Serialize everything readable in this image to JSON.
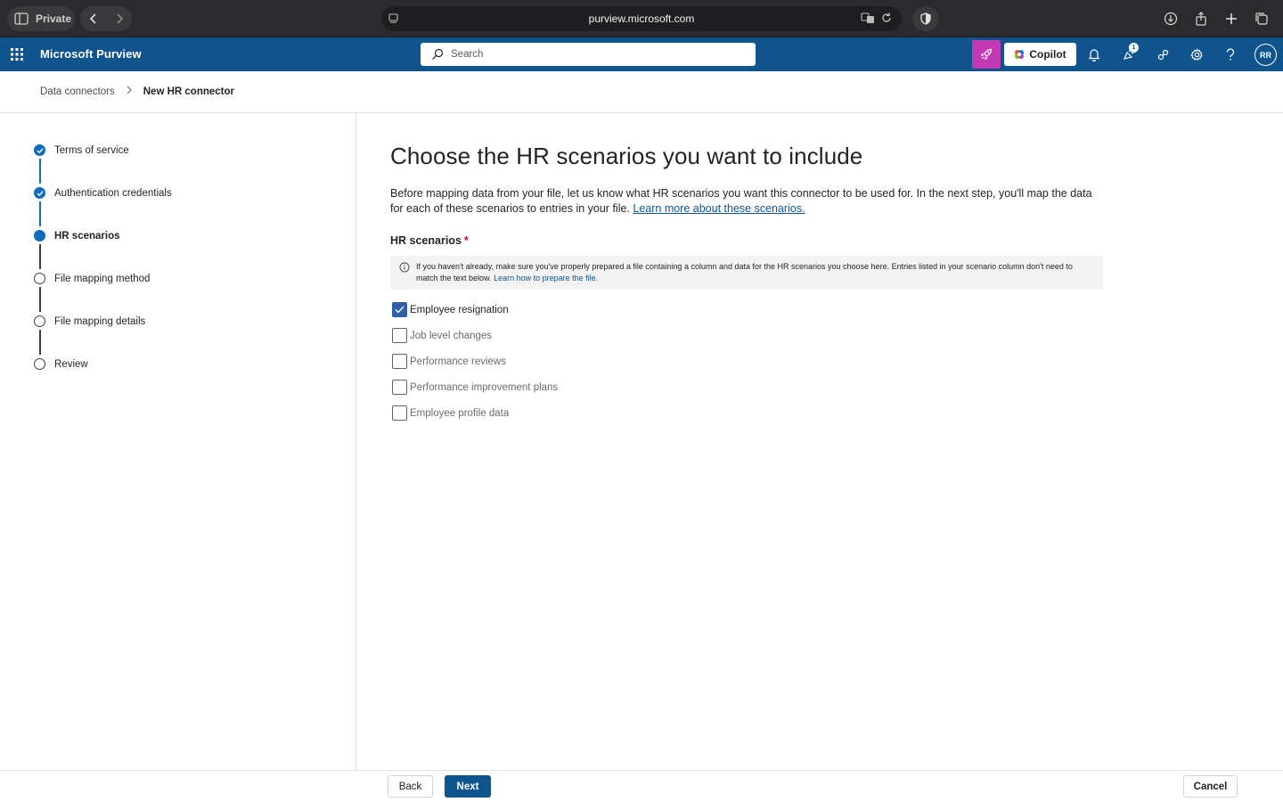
{
  "browser": {
    "private_label": "Private",
    "url": "purview.microsoft.com"
  },
  "header": {
    "app_title": "Microsoft Purview",
    "search_placeholder": "Search",
    "copilot_label": "Copilot",
    "notification_count": "1",
    "avatar_initials": "RR"
  },
  "breadcrumb": {
    "parent": "Data connectors",
    "current": "New HR connector"
  },
  "steps": [
    {
      "label": "Terms of service",
      "state": "done"
    },
    {
      "label": "Authentication credentials",
      "state": "done"
    },
    {
      "label": "HR scenarios",
      "state": "current"
    },
    {
      "label": "File mapping method",
      "state": "todo"
    },
    {
      "label": "File mapping details",
      "state": "todo"
    },
    {
      "label": "Review",
      "state": "todo"
    }
  ],
  "main": {
    "title": "Choose the HR scenarios you want to include",
    "description": "Before mapping data from your file, let us know what HR scenarios you want this connector to be used for. In the next step, you'll map the data for each of these scenarios to entries in your file.",
    "description_link": "Learn more about these scenarios.",
    "section_label": "HR scenarios",
    "required_marker": "*",
    "info_text": "If you haven't already, make sure you've properly prepared a file containing a column and data for the HR scenarios you choose here. Entries listed in your scenario column don't need to match the text below.",
    "info_link": "Learn how to prepare the file.",
    "scenarios": [
      {
        "label": "Employee resignation",
        "checked": true
      },
      {
        "label": "Job level changes",
        "checked": false
      },
      {
        "label": "Performance reviews",
        "checked": false
      },
      {
        "label": "Performance improvement plans",
        "checked": false
      },
      {
        "label": "Employee profile data",
        "checked": false
      }
    ]
  },
  "footer": {
    "back_label": "Back",
    "next_label": "Next",
    "cancel_label": "Cancel"
  },
  "colors": {
    "header_bg": "#0f548c",
    "accent": "#0f6cbd",
    "purple": "#c239b3",
    "required": "#c50f1f"
  }
}
